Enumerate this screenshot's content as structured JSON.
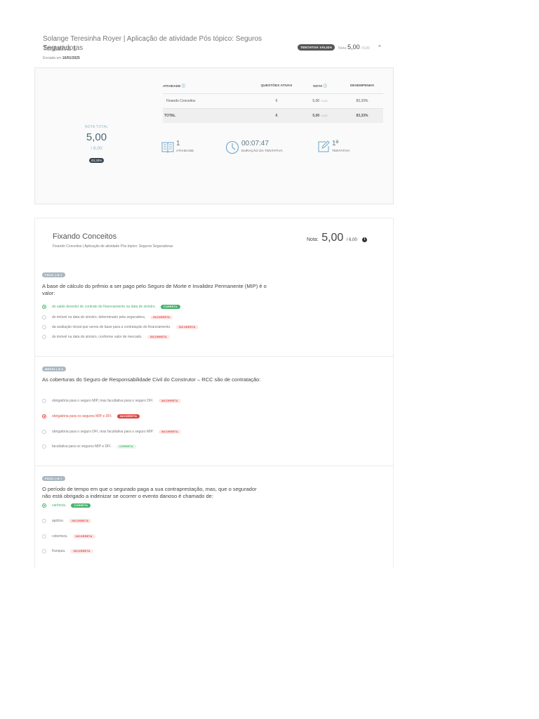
{
  "header": {
    "title": "Solange Teresinha Royer | Aplicação de atividade Pós tópico: Seguros Seguradoras",
    "attempt": "Tentativa 1",
    "sent_label": "Enviada em",
    "sent_date": "16/01/2025",
    "valid_badge": "TENTATIVA VÁLIDA",
    "grade_label": "Nota",
    "grade_value": "5,00",
    "grade_max": "/ 6,00"
  },
  "summary": {
    "total_label": "NOTA TOTAL",
    "total_value": "5,00",
    "total_max": "/ 6,00",
    "percent": "83,33%",
    "table": {
      "headers": [
        "ATIVIDADE",
        "QUESTÕES ATIVAS",
        "NOTA",
        "DESEMPENHO"
      ],
      "rows": [
        {
          "name": "Fixando Conceitos",
          "questions": "6",
          "grade": "5,00",
          "max": "/ 6,00",
          "performance": "83,33%"
        }
      ],
      "total": {
        "name": "TOTAL",
        "questions": "6",
        "grade": "5,00",
        "max": "/ 6,00",
        "performance": "83,33%"
      }
    },
    "stats": [
      {
        "icon": "book-icon",
        "value": "1",
        "caption": "ATIVIDADE"
      },
      {
        "icon": "clock-icon",
        "value": "00:07:47",
        "caption": "DURAÇÃO DA TENTATIVA"
      },
      {
        "icon": "edit-icon",
        "value": "1ª",
        "caption": "TENTATIVA"
      }
    ]
  },
  "exercise": {
    "title": "Fixando Conceitos",
    "subtitle": "Fixando Conceitos | Aplicação de atividade Pós tópico: Seguros Seguradoras",
    "grade_label": "Nota:",
    "grade_value": "5,00",
    "grade_max": "/ 6,00",
    "questions": [
      {
        "tag": "FÁCIL | N 1",
        "text": "A base de cálculo do prêmio a ser pago pelo Seguro de Morte e Invalidez Permanente (MIP) é o valor:",
        "options": [
          {
            "text": "do saldo devedor do contrato de financiamento na data do sinistro.",
            "status": "CORRETA"
          },
          {
            "text": "do imóvel na data do sinistro, determinado pela seguradora.",
            "status": "INCORRETA"
          },
          {
            "text": "da avaliação inicial que serviu de base para a contratação do financiamento.",
            "status": "INCORRETA"
          },
          {
            "text": "do imóvel na data do sinistro, conforme valor de mercado.",
            "status": "INCORRETA"
          }
        ]
      },
      {
        "tag": "MÉDIO | N 8",
        "text": "As coberturas do Seguro de Responsabilidade Civil do Construtor – RCC são de contratação:",
        "options": [
          {
            "text": "obrigatória para o seguro MIP, mas facultativa para o seguro DFI.",
            "status": "INCORRETA"
          },
          {
            "text": "obrigatória para os seguros MIP e DFI.",
            "status": "INCORRETA"
          },
          {
            "text": "obrigatória para o seguro DFI, mas facultativa para o seguro MIP.",
            "status": "INCORRETA"
          },
          {
            "text": "facultativa para os seguros MIP e DFI.",
            "status": "CORRETA"
          }
        ]
      },
      {
        "tag": "FÁCIL | N 7",
        "text": "O período de tempo em que o segurado paga a sua contraprestação, mas, que o segurador não está obrigado a indenizar se ocorrer o evento danoso é chamado de:",
        "options": [
          {
            "text": "carência.",
            "status": "CORRETA"
          },
          {
            "text": "apólice.",
            "status": "INCORRETA"
          },
          {
            "text": "cobertura.",
            "status": "INCORRETA"
          },
          {
            "text": "franquia.",
            "status": "INCORRETA"
          }
        ]
      }
    ]
  },
  "colors": {
    "correct": "#45b26b",
    "incorrect": "#e2463d",
    "accent": "#6aa6c7"
  }
}
